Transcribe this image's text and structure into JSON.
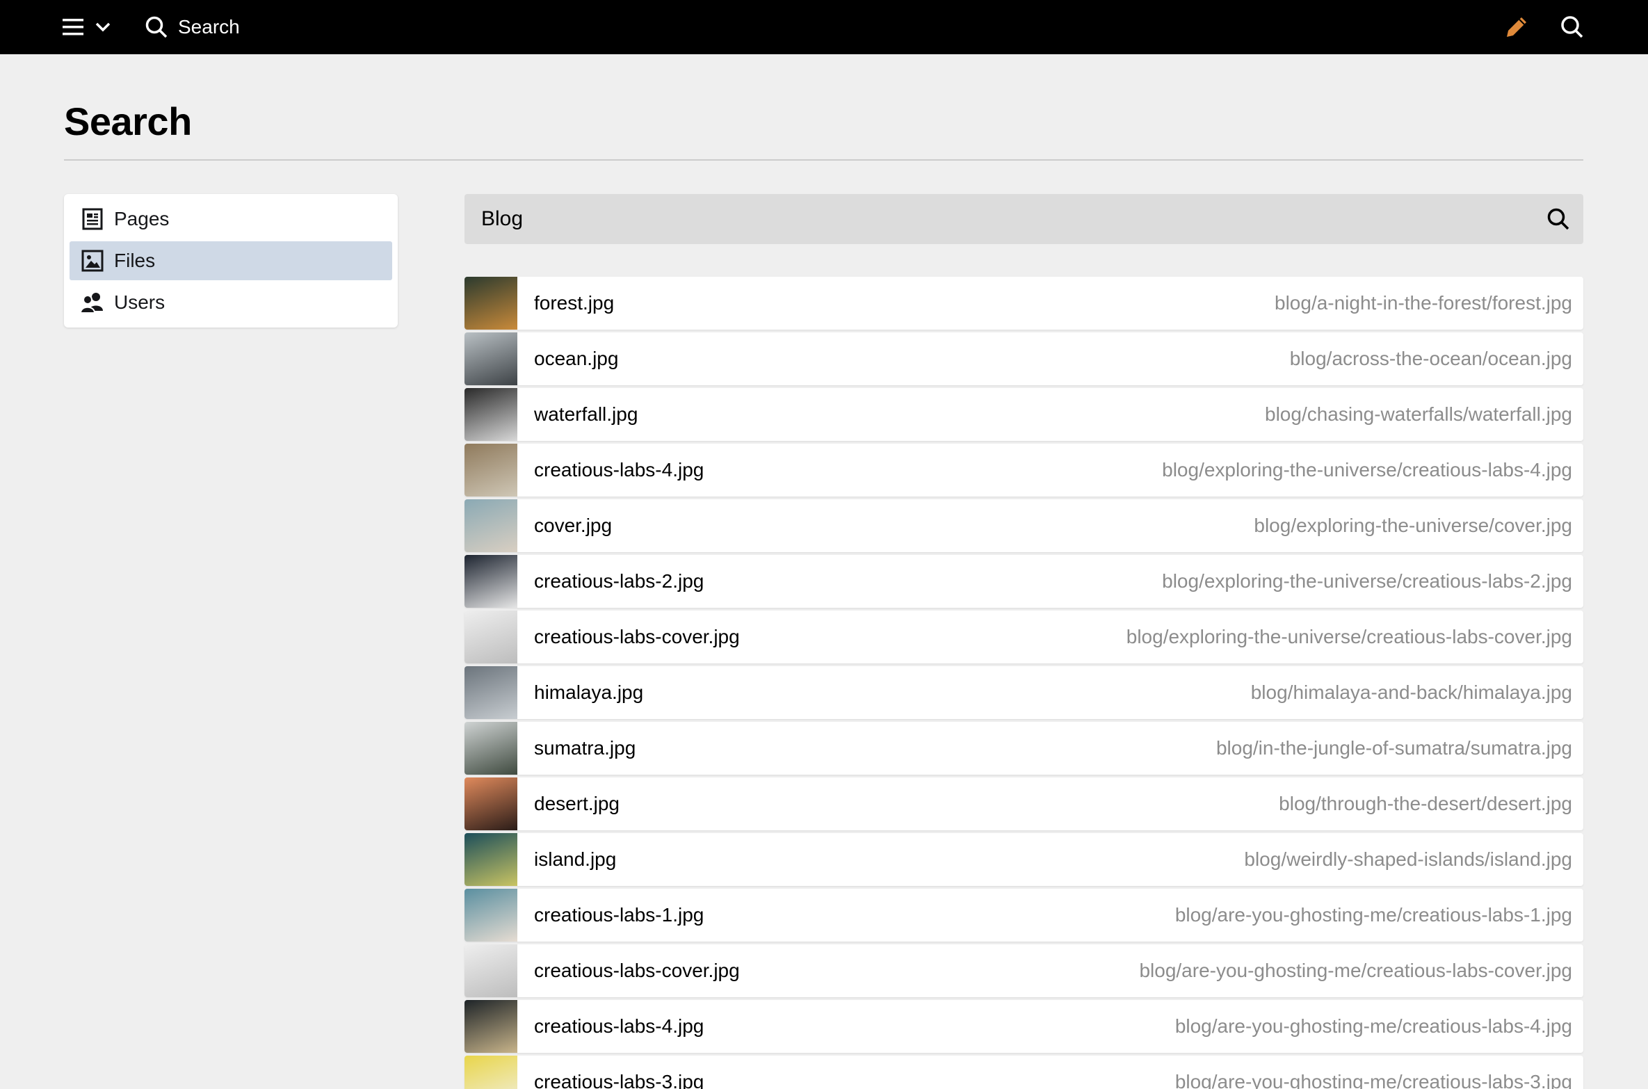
{
  "topbar": {
    "search_label": "Search"
  },
  "page": {
    "title": "Search"
  },
  "sidebar": {
    "items": [
      {
        "label": "Pages",
        "icon": "page-icon",
        "active": false
      },
      {
        "label": "Files",
        "icon": "image-icon",
        "active": true
      },
      {
        "label": "Users",
        "icon": "users-icon",
        "active": false
      }
    ]
  },
  "search": {
    "value": "Blog"
  },
  "results": [
    {
      "name": "forest.jpg",
      "path": "blog/a-night-in-the-forest/forest.jpg",
      "thumb": [
        "#2b3a2e",
        "#c98a3a"
      ]
    },
    {
      "name": "ocean.jpg",
      "path": "blog/across-the-ocean/ocean.jpg",
      "thumb": [
        "#b9c0c4",
        "#3d4246"
      ]
    },
    {
      "name": "waterfall.jpg",
      "path": "blog/chasing-waterfalls/waterfall.jpg",
      "thumb": [
        "#2a2a2a",
        "#d8d8d8"
      ]
    },
    {
      "name": "creatious-labs-4.jpg",
      "path": "blog/exploring-the-universe/creatious-labs-4.jpg",
      "thumb": [
        "#8f7a5c",
        "#cfc7b6"
      ]
    },
    {
      "name": "cover.jpg",
      "path": "blog/exploring-the-universe/cover.jpg",
      "thumb": [
        "#8aa9b4",
        "#d9cfc2"
      ]
    },
    {
      "name": "creatious-labs-2.jpg",
      "path": "blog/exploring-the-universe/creatious-labs-2.jpg",
      "thumb": [
        "#1d2430",
        "#e6e6e6"
      ]
    },
    {
      "name": "creatious-labs-cover.jpg",
      "path": "blog/exploring-the-universe/creatious-labs-cover.jpg",
      "thumb": [
        "#eeeeee",
        "#bdbdbd"
      ]
    },
    {
      "name": "himalaya.jpg",
      "path": "blog/himalaya-and-back/himalaya.jpg",
      "thumb": [
        "#6b747c",
        "#c8cdd1"
      ]
    },
    {
      "name": "sumatra.jpg",
      "path": "blog/in-the-jungle-of-sumatra/sumatra.jpg",
      "thumb": [
        "#cfd3d3",
        "#3f4a3f"
      ]
    },
    {
      "name": "desert.jpg",
      "path": "blog/through-the-desert/desert.jpg",
      "thumb": [
        "#e08a5c",
        "#2a1c18"
      ]
    },
    {
      "name": "island.jpg",
      "path": "blog/weirdly-shaped-islands/island.jpg",
      "thumb": [
        "#1c4e5a",
        "#c9c463"
      ]
    },
    {
      "name": "creatious-labs-1.jpg",
      "path": "blog/are-you-ghosting-me/creatious-labs-1.jpg",
      "thumb": [
        "#5a8fa0",
        "#e6dcd2"
      ]
    },
    {
      "name": "creatious-labs-cover.jpg",
      "path": "blog/are-you-ghosting-me/creatious-labs-cover.jpg",
      "thumb": [
        "#eeeeee",
        "#bdbdbd"
      ]
    },
    {
      "name": "creatious-labs-4.jpg",
      "path": "blog/are-you-ghosting-me/creatious-labs-4.jpg",
      "thumb": [
        "#1e2428",
        "#c8b48a"
      ]
    },
    {
      "name": "creatious-labs-3.jpg",
      "path": "blog/are-you-ghosting-me/creatious-labs-3.jpg",
      "thumb": [
        "#e8d54a",
        "#f2f0e0"
      ]
    }
  ],
  "colors": {
    "topbar_bg": "#000000",
    "page_bg": "#efefef",
    "active_item_bg": "#cfd9e6",
    "pen_icon": "#e08a3a",
    "path_text": "#8c8c8c"
  }
}
